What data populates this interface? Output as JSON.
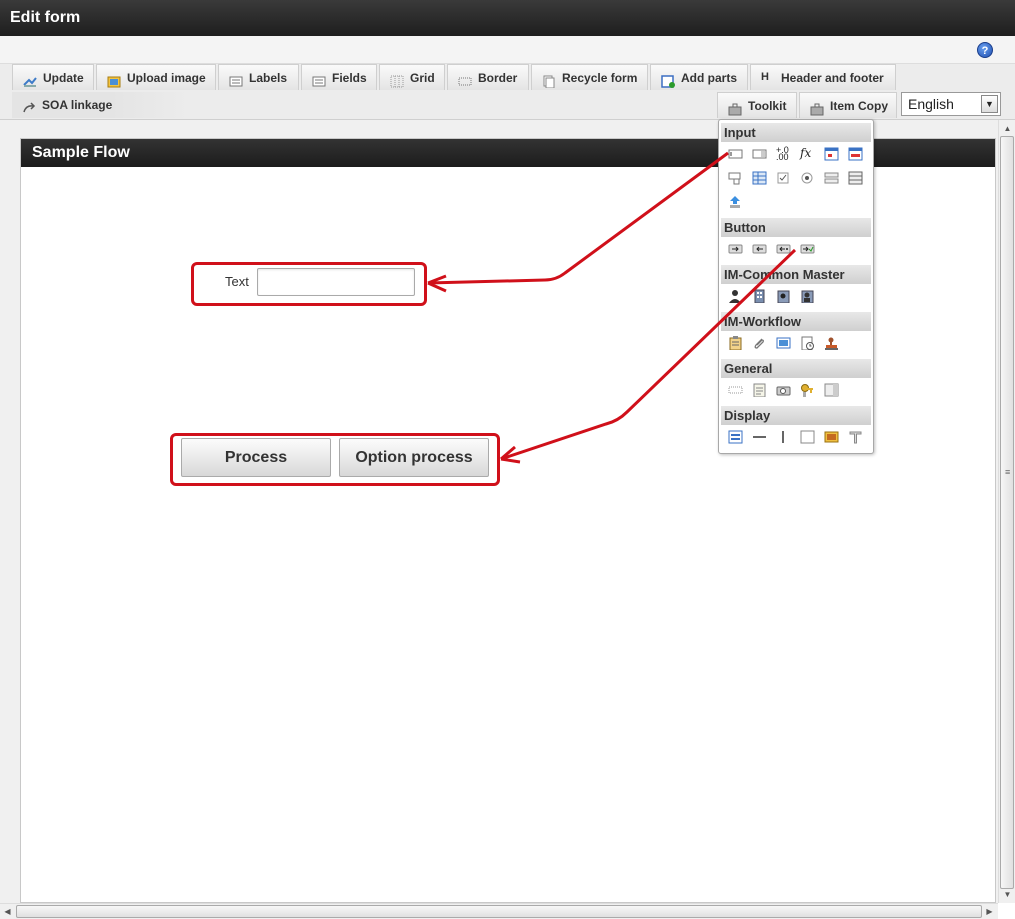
{
  "window": {
    "title": "Edit form"
  },
  "toolbar": {
    "tabs": [
      "Update",
      "Upload image",
      "Labels",
      "Fields",
      "Grid",
      "Border",
      "Recycle form",
      "Add parts",
      "Header and footer"
    ],
    "row2": {
      "soa": "SOA linkage",
      "toolkit": "Toolkit",
      "item_copy": "Item Copy"
    },
    "language": "English"
  },
  "form": {
    "title": "Sample Flow",
    "text_label": "Text",
    "buttons": [
      "Process",
      "Option process"
    ]
  },
  "toolkit": {
    "sections": [
      "Input",
      "Button",
      "IM-Common Master",
      "IM-Workflow",
      "General",
      "Display"
    ],
    "icon_names": {
      "input": [
        "textbox-icon",
        "textbox-lookup-icon",
        "number-icon",
        "formula-icon",
        "date-icon",
        "date-range-icon",
        "select-icon",
        "grid-select-icon",
        "checkbox-icon",
        "radio-icon",
        "list-icon",
        "table-icon",
        "file-upload-icon"
      ],
      "button": [
        "next-button-icon",
        "back-button-icon",
        "option-back-icon",
        "option-next-icon"
      ],
      "common_master": [
        "user-icon",
        "company-icon",
        "organization-icon",
        "role-icon"
      ],
      "workflow": [
        "clipboard-icon",
        "attachment-icon",
        "image-icon",
        "history-icon",
        "stamp-icon"
      ],
      "general": [
        "hidden-field-icon",
        "document-icon",
        "camera-icon",
        "key-icon",
        "panel-icon"
      ],
      "display": [
        "label-icon",
        "horizontal-line-icon",
        "vertical-line-icon",
        "box-icon",
        "picture-icon",
        "text-icon"
      ]
    }
  },
  "colors": {
    "highlight": "#d0101a",
    "titlebar": "#1e1e1e"
  }
}
